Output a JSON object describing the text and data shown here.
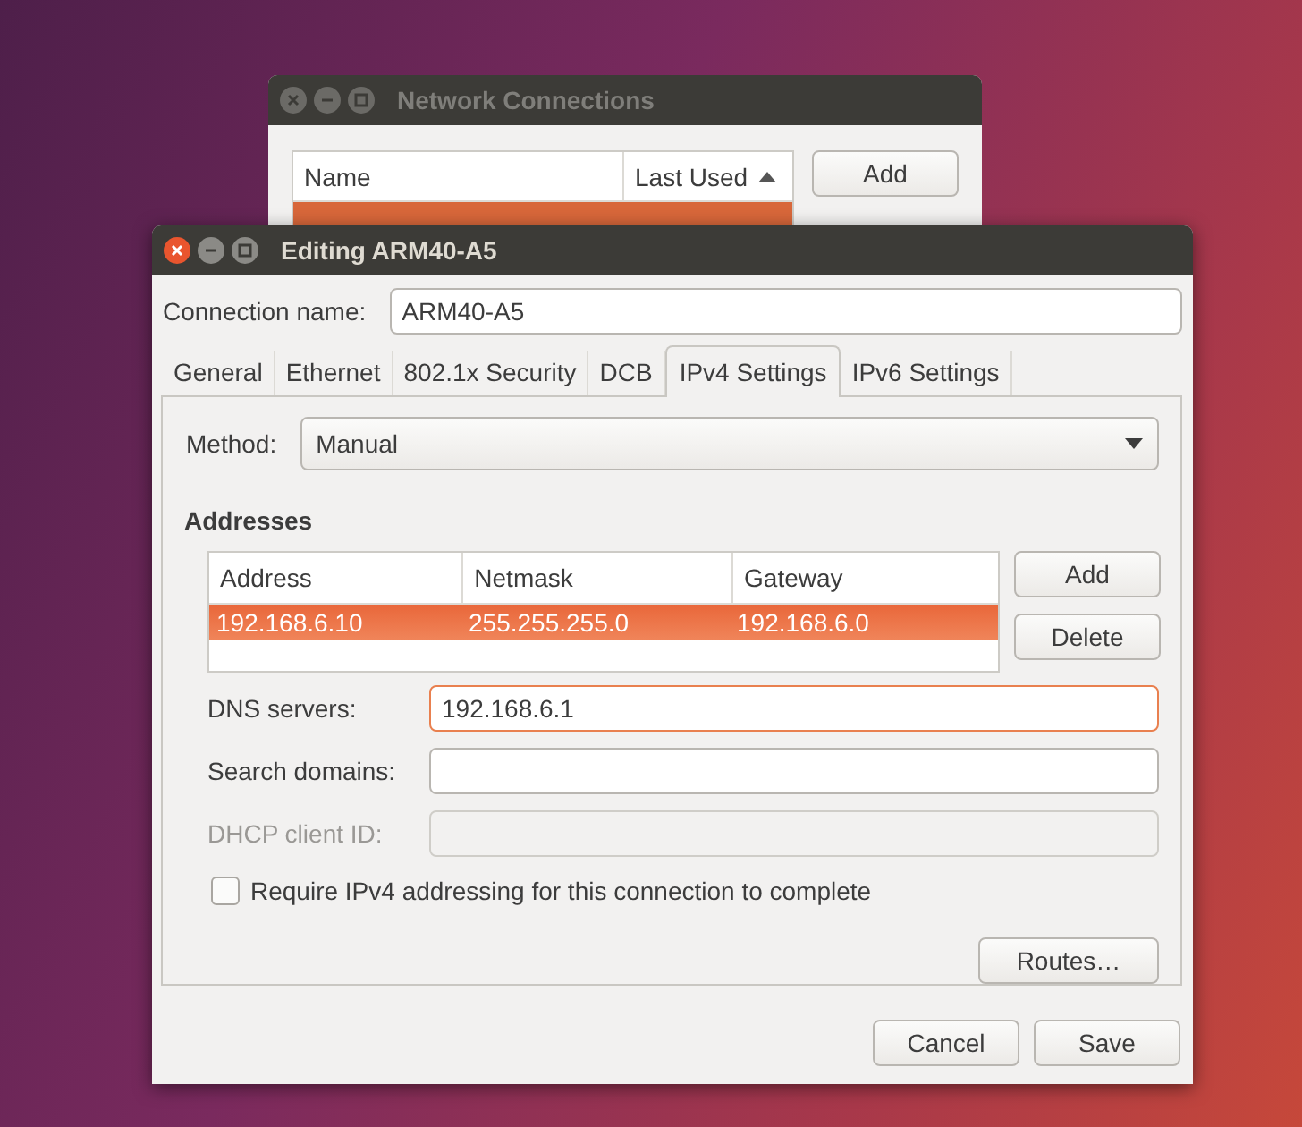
{
  "background_window": {
    "title": "Network Connections",
    "active": false,
    "columns": [
      {
        "label": "Name",
        "sorted": false
      },
      {
        "label": "Last Used",
        "sorted": true
      }
    ],
    "rows": [
      {
        "selected": true
      }
    ],
    "buttons": [
      "Add"
    ]
  },
  "dialog": {
    "title": "Editing ARM40-A5",
    "active": true,
    "connection_name": {
      "label": "Connection name:",
      "value": "ARM40-A5"
    },
    "tabs": [
      {
        "label": "General",
        "selected": false
      },
      {
        "label": "Ethernet",
        "selected": false
      },
      {
        "label": "802.1x Security",
        "selected": false
      },
      {
        "label": "DCB",
        "selected": false
      },
      {
        "label": "IPv4 Settings",
        "selected": true
      },
      {
        "label": "IPv6 Settings",
        "selected": false
      }
    ],
    "method": {
      "label": "Method:",
      "value": "Manual"
    },
    "addresses": {
      "heading": "Addresses",
      "columns": [
        "Address",
        "Netmask",
        "Gateway"
      ],
      "rows": [
        {
          "cells": [
            "192.168.6.10",
            "255.255.255.0",
            "192.168.6.0"
          ],
          "selected": true
        }
      ],
      "buttons": [
        "Add",
        "Delete"
      ]
    },
    "fields": [
      {
        "label": "DNS servers:",
        "value": "192.168.6.1",
        "focused": true,
        "disabled": false
      },
      {
        "label": "Search domains:",
        "focused": false,
        "disabled": false
      },
      {
        "label": "DHCP client ID:",
        "focused": false,
        "disabled": true
      }
    ],
    "require_checkbox": {
      "label": "Require IPv4 addressing for this connection to complete",
      "checked": false
    },
    "routes_button": "Routes…",
    "buttons": [
      "Cancel",
      "Save"
    ]
  }
}
